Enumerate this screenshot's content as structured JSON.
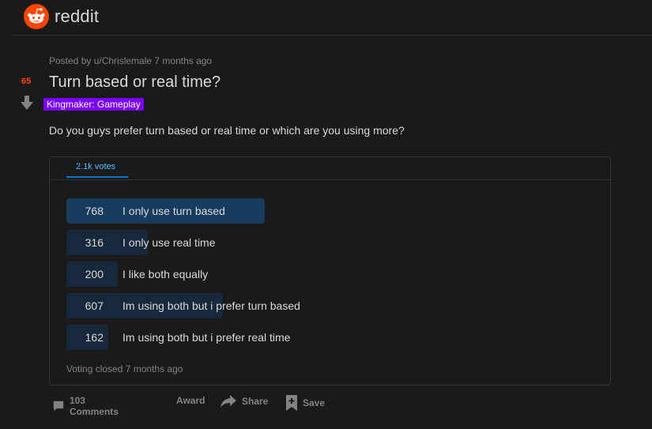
{
  "header": {
    "brand": "reddit"
  },
  "post": {
    "score": "65",
    "posted_by": "Posted by u/Chrislemale 7 months ago",
    "title": "Turn based or real time?",
    "flair": "Kingmaker: Gameplay",
    "body": "Do you guys prefer turn based or real time or which are you using more?"
  },
  "poll": {
    "tab_label": "2.1k votes",
    "options": [
      {
        "count": "768",
        "label": "I only use turn based",
        "fraction": 1.0,
        "winner": true
      },
      {
        "count": "316",
        "label": "I only use real time",
        "fraction": 0.411,
        "winner": false
      },
      {
        "count": "200",
        "label": "I like both equally",
        "fraction": 0.26,
        "winner": false
      },
      {
        "count": "607",
        "label": "Im using both but i prefer turn based",
        "fraction": 0.79,
        "winner": false
      },
      {
        "count": "162",
        "label": "Im using both but i prefer real time",
        "fraction": 0.211,
        "winner": false
      }
    ],
    "status": "Voting closed 7 months ago"
  },
  "actions": {
    "comments": "103 Comments",
    "award": "Award",
    "share": "Share",
    "save": "Save"
  },
  "colors": {
    "background": "#1a1a1b",
    "accent_orange": "#ff4500",
    "flair_purple": "#7a00ff",
    "tab_blue": "#0079d3",
    "winner_bar": "#183c5e",
    "bar": "#17283a"
  }
}
